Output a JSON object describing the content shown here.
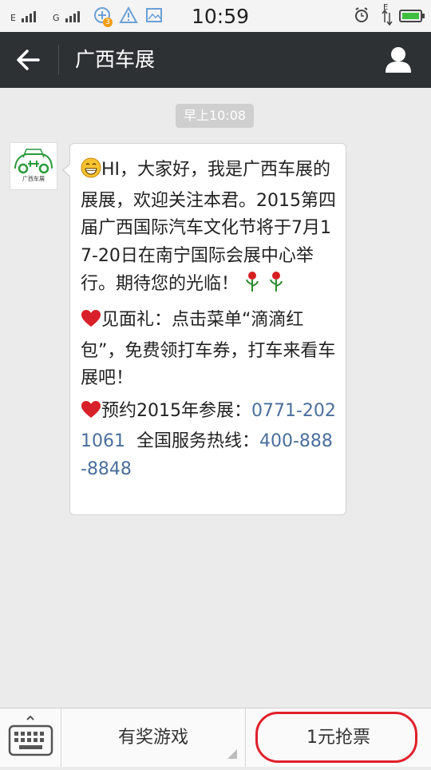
{
  "status_bar": {
    "sim1_label": "E",
    "sim2_label": "G",
    "notify_badge": "3",
    "battery_label": "E",
    "time": "10:59"
  },
  "header": {
    "title": "广西车展"
  },
  "chat": {
    "timestamp": "早上10:08",
    "avatar_caption": "广西车展",
    "message": {
      "para1": "HI，大家好，我是广西车展的展展，欢迎关注本君。2015第四届广西国际汽车文化节将于7月17-20日在南宁国际会展中心举行。期待您的光临！",
      "para2": "见面礼：点击菜单“滴滴红包”，免费领打车券，打车来看车展吧！",
      "para3_prefix": "预约2015年参展：",
      "phone1": "0771-2021061",
      "para3_mid": "  全国服务热线：",
      "phone2": "400-888-8848"
    }
  },
  "bottom_menu": {
    "item1": "有奖游戏",
    "item2": "1元抢票"
  },
  "colors": {
    "titlebar": "#2d3133",
    "link": "#4a6f9c",
    "highlight_circle": "#e0202a"
  }
}
